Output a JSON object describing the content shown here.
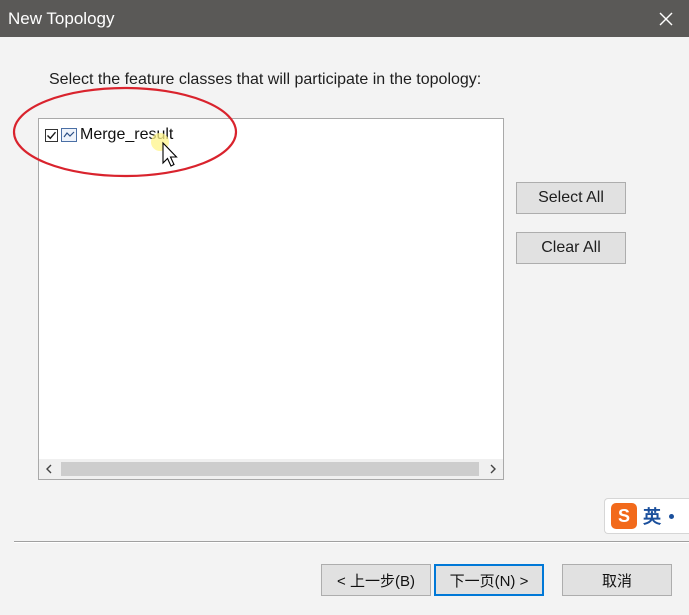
{
  "window": {
    "title": "New Topology"
  },
  "instruction": "Select the feature classes that will participate in the topology:",
  "feature_list": {
    "items": [
      {
        "label": "Merge_result",
        "checked": true,
        "icon": "line-feature-class-icon"
      }
    ]
  },
  "buttons": {
    "select_all": "Select All",
    "clear_all": "Clear All",
    "back": "< 上一步(B)",
    "next": "下一页(N) >",
    "cancel": "取消"
  },
  "ime": {
    "lang": "英",
    "logo": "S"
  },
  "colors": {
    "titlebar": "#5a5957",
    "annotation_ring": "#d9232d",
    "ime_orange": "#f26a1b"
  }
}
